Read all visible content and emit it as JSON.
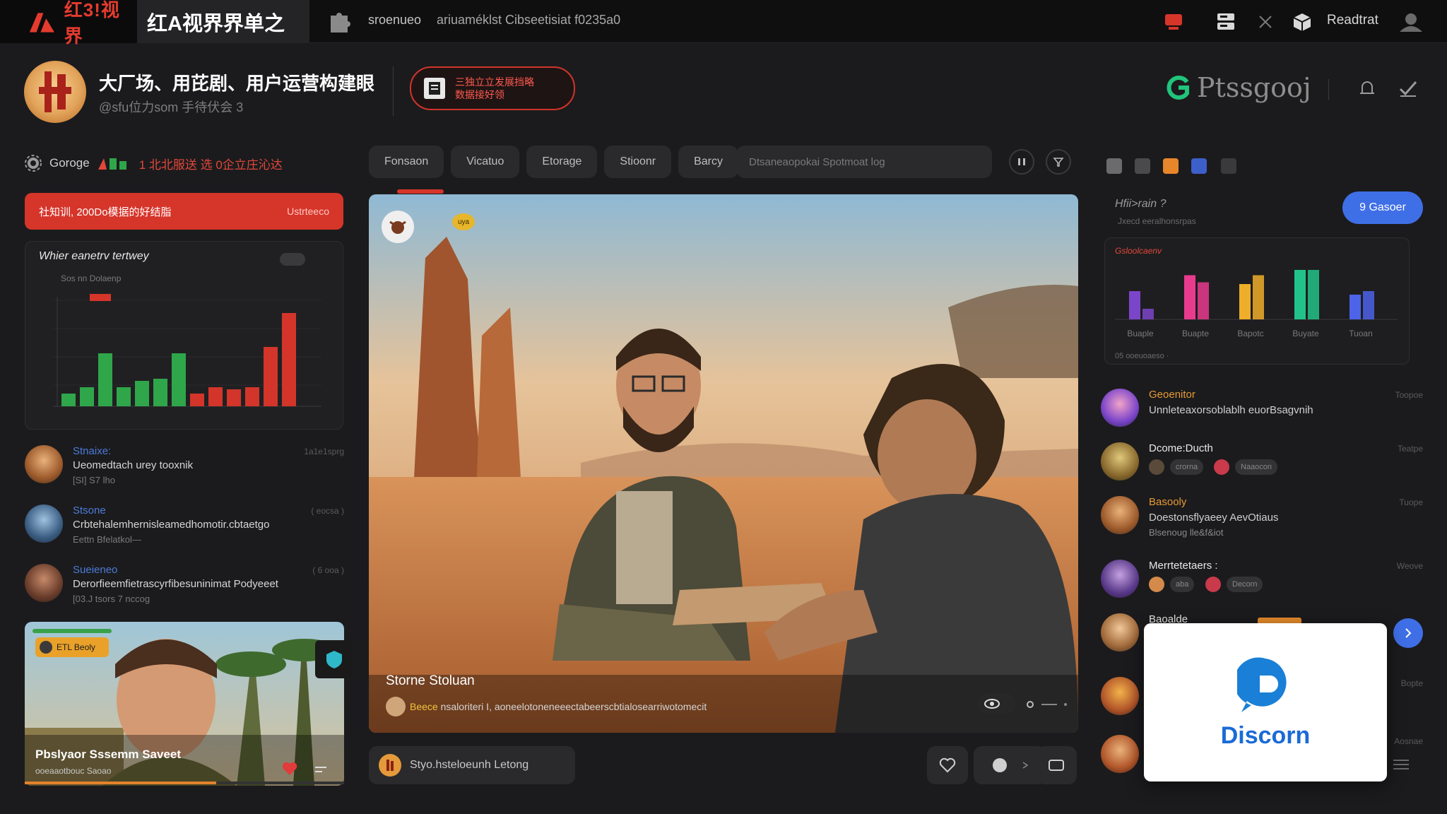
{
  "topbar": {
    "brand": "红3!视界",
    "app_title": "红A视界界单之",
    "nav_1": "sroenueo",
    "nav_2": "ariuaméklst Cibseetisiat f0235a0",
    "user_label": "Readtrat"
  },
  "header": {
    "title": "大厂场、用芘剧、用户运营构建眼",
    "subtitle": "@sfu位力som 手待伏会 3",
    "promo_line1": "三独立立发展挡略",
    "promo_line2": "数据接好领",
    "right_brand": "Ptssgooj"
  },
  "left": {
    "section_label": "Goroge",
    "section_tag": "1 北北服送 选  0企立庄沁达",
    "red_banner_text": "社知训, 200Do模据的好结脂",
    "red_banner_right": "Ustrteeco",
    "chart_title": "Whier eanetrv tertwey",
    "chart_sub": "Sos   nn Dolaenp",
    "chart_data": {
      "type": "bar",
      "title": "",
      "values": [
        6,
        9,
        25,
        9,
        12,
        13,
        25,
        6,
        9,
        8,
        9,
        28,
        44
      ],
      "colors": [
        "#2fa64a",
        "#2fa64a",
        "#2fa64a",
        "#2fa64a",
        "#2fa64a",
        "#2fa64a",
        "#2fa64a",
        "#d3352a",
        "#d3352a",
        "#d3352a",
        "#d3352a",
        "#d3352a",
        "#d3352a"
      ],
      "ylim": [
        0,
        50
      ]
    },
    "feed": [
      {
        "name": "Stnaixe:",
        "time": "1a1e1sprg",
        "text": "Ueomedtach urey  tooxnik",
        "meta": "[SI] S7 lho"
      },
      {
        "name": "Stsone",
        "time": "( eocsa )",
        "text": "Crbtehalemhernisleamedhomotir.cbtaetgo",
        "meta": "Eettn   Bfelatkol—"
      },
      {
        "name": "Sueieneo",
        "time": "( 6 ooa )",
        "text": "Derorfieemfietrascyrfibesuninimat Podyeeet",
        "meta": "[03.J tsors 7 nccog"
      }
    ],
    "video": {
      "badge": "ETL Beoly",
      "title": "Pbslyaor Sssemm Saveet",
      "sub": "ooeaaotbouc Saoao",
      "progress": 0.6
    }
  },
  "center": {
    "tabs": [
      "Fonsaon",
      "Vicatuo",
      "Etorage",
      "Stioonr",
      "Barcy"
    ],
    "search_placeholder": "Dtsaneaopokai Spotmoat log",
    "hero": {
      "top_badge": "uya",
      "caption": "Storne Stoluan",
      "line_highlight": "Beece",
      "line_rest": "nsaloriteri I, aoneelotoneneeectabeerscbtialosearriwotomecit"
    },
    "compose_text": "Styo.hsteloeunh Letong"
  },
  "right": {
    "title": "Hfii>rain ?",
    "sub": "Jxecd eeralhonsrpas",
    "blue_button": "9 Gasoer",
    "chart_legend": "Gsloolcaenv",
    "chart_foot": "05  ooeuoaeso  ·",
    "chart_data": {
      "type": "bar",
      "categories": [
        "Buaple",
        "Buapte",
        "Bapotc",
        "Buyate",
        "Tuoan"
      ],
      "series": [
        {
          "name": "",
          "values": [
            16,
            6
          ]
        },
        {
          "name": "",
          "values": [
            25,
            21
          ]
        },
        {
          "name": "",
          "values": [
            20,
            25
          ]
        },
        {
          "name": "",
          "values": [
            28,
            28
          ]
        },
        {
          "name": "",
          "values": [
            14,
            16
          ]
        }
      ],
      "colors": [
        "#7b45c9",
        "#e83b8e",
        "#efae2a",
        "#22c388",
        "#4d63e8"
      ],
      "ylim": [
        0,
        32
      ]
    },
    "messages": [
      {
        "name": "Geoenitor",
        "time": "Toopoe",
        "text": "Unnleteaxorsoblablh  euorBsagvnih"
      },
      {
        "name": "Dcome:Ducth",
        "time": "Teatpe",
        "chip_1": "crorna",
        "chip_2": "Naaocon"
      },
      {
        "name": "Basooly",
        "time": "Tuope",
        "text": "Doestonsflyaeey AevOtiaus",
        "text_2": "Blsenoug lle&f&iot"
      },
      {
        "name": "Merrtetetaers :",
        "time": "Weove",
        "chip_1": "aba",
        "chip_2": "Decorn"
      },
      {
        "name": "Baoalde",
        "time": "",
        "text": ""
      },
      {
        "name": "",
        "time": "Bopte",
        "text": ""
      },
      {
        "name": "",
        "time": "Aosnae",
        "text": ""
      }
    ],
    "discord_label": "Discorn"
  },
  "colors": {
    "accent_red": "#d6352a",
    "accent_blue": "#3f6fe6",
    "bg": "#1b1b1d"
  }
}
